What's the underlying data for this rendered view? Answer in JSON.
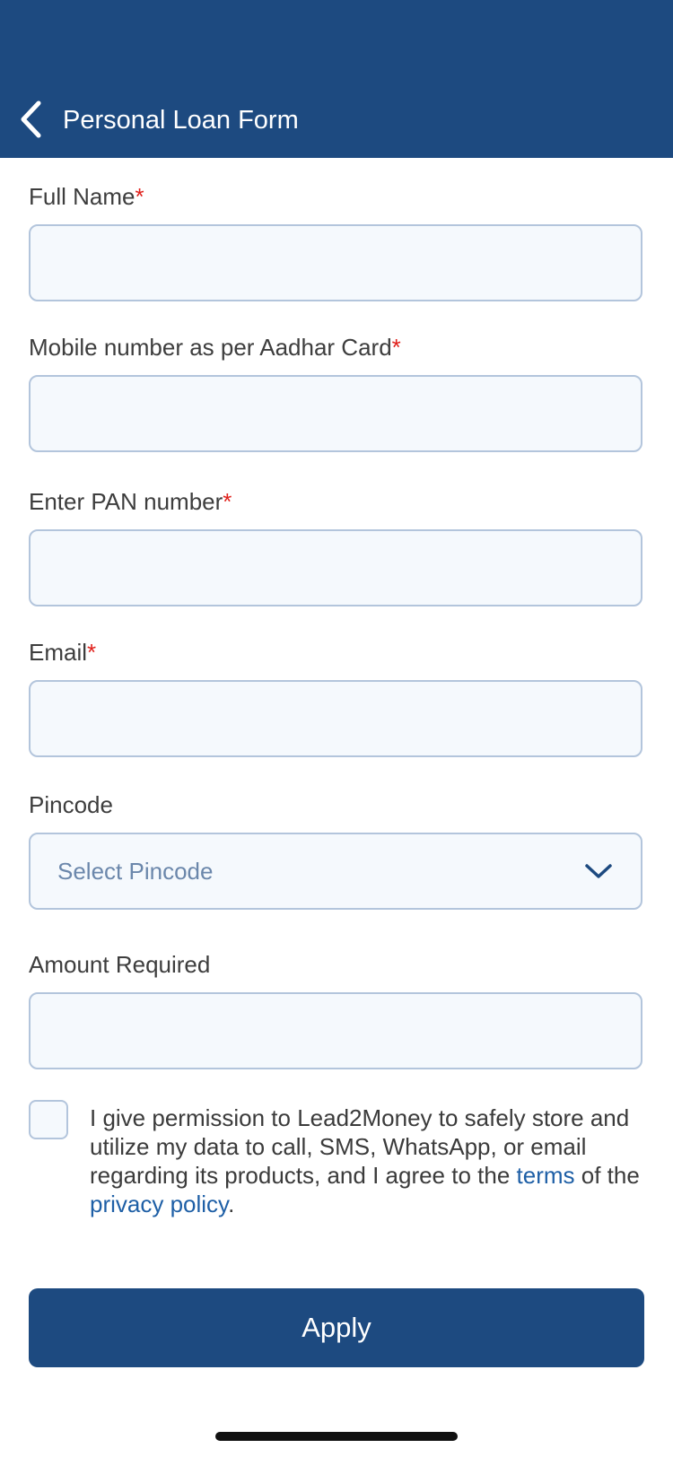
{
  "header": {
    "title": "Personal Loan Form",
    "back_icon": "chevron-left-icon",
    "background_color": "#1d4a80"
  },
  "form": {
    "full_name": {
      "label": "Full Name",
      "required_mark": "*",
      "value": ""
    },
    "mobile": {
      "label": "Mobile number as per Aadhar Card",
      "required_mark": "*",
      "value": ""
    },
    "pan": {
      "label": "Enter PAN number",
      "required_mark": "*",
      "value": ""
    },
    "email": {
      "label": "Email",
      "required_mark": "*",
      "value": ""
    },
    "pincode": {
      "label": "Pincode",
      "placeholder": "Select Pincode",
      "icon": "chevron-down-icon"
    },
    "amount": {
      "label": "Amount Required",
      "value": ""
    }
  },
  "consent": {
    "checked": false,
    "text_before": "I give permission to Lead2Money to safely store and utilize my data to call, SMS, WhatsApp, or email regarding its products, and I agree to the ",
    "terms_link": "terms",
    "text_middle": " of the ",
    "privacy_link": "privacy policy",
    "text_after": "."
  },
  "apply_button": {
    "label": "Apply"
  },
  "colors": {
    "primary": "#1d4a80",
    "required": "#e0201b",
    "link": "#1e5fa6",
    "field_background": "#f5f9fd",
    "field_border": "#b3c5dc"
  }
}
